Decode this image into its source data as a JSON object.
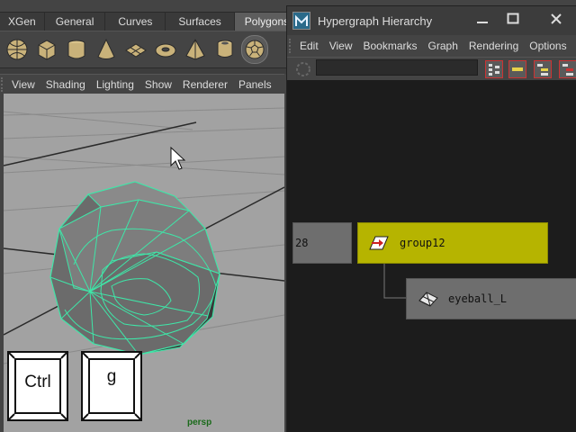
{
  "main": {
    "shelf_tabs": [
      {
        "label": "XGen",
        "width": 40
      },
      {
        "label": "General",
        "width": 68
      },
      {
        "label": "Curves",
        "width": 62
      },
      {
        "label": "Surfaces",
        "width": 76
      },
      {
        "label": "Polygons",
        "width": 74,
        "active": true
      }
    ],
    "panel_menu": [
      "View",
      "Shading",
      "Lighting",
      "Show",
      "Renderer",
      "Panels"
    ],
    "camera_label": "persp"
  },
  "keys": {
    "first": "Ctrl",
    "second": "g"
  },
  "hypergraph": {
    "title": "Hypergraph Hierarchy",
    "window_controls": {
      "minimize": "—",
      "maximize": "□",
      "close": "✕"
    },
    "menu": [
      "Edit",
      "View",
      "Bookmarks",
      "Graph",
      "Rendering",
      "Options"
    ],
    "nodes": {
      "partial_label": "28",
      "group_label": "group12",
      "child_label": "eyeball_L"
    }
  },
  "colors": {
    "selected_node": "#b6b400",
    "node_gray": "#6e6e6e",
    "wireframe": "#3fe6a8",
    "viewport_bg": "#a2a2a2",
    "graph_bg": "#1c1c1c"
  }
}
